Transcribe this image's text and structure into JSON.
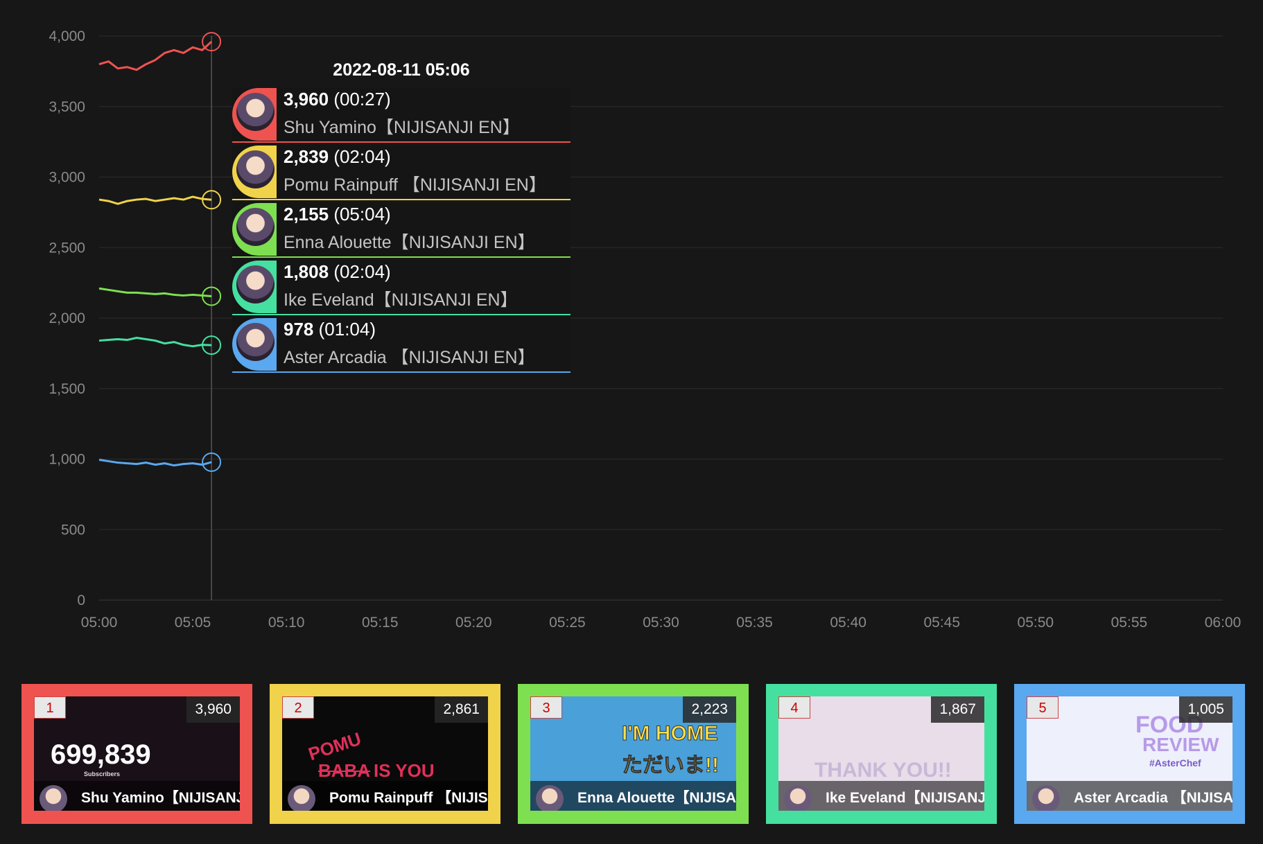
{
  "chart_data": {
    "type": "line",
    "title": "",
    "xlabel": "",
    "ylabel": "",
    "ylim": [
      0,
      4000
    ],
    "xlim": [
      "05:00",
      "06:00"
    ],
    "yticks": [
      "0",
      "500",
      "1,000",
      "1,500",
      "2,000",
      "2,500",
      "3,000",
      "3,500",
      "4,000"
    ],
    "xticks": [
      "05:00",
      "05:05",
      "05:10",
      "05:15",
      "05:20",
      "05:25",
      "05:30",
      "05:35",
      "05:40",
      "05:45",
      "05:50",
      "05:55",
      "06:00"
    ],
    "grid": true,
    "cursor_x": 6,
    "series": [
      {
        "name": "Shu Yamino【NIJISANJI EN】",
        "color": "#ef5350",
        "x": [
          0,
          0.5,
          1,
          1.5,
          2,
          2.5,
          3,
          3.5,
          4,
          4.5,
          5,
          5.5,
          6
        ],
        "values": [
          3800,
          3820,
          3770,
          3780,
          3760,
          3800,
          3830,
          3880,
          3900,
          3880,
          3920,
          3900,
          3960
        ]
      },
      {
        "name": "Pomu Rainpuff 【NIJISANJI EN】",
        "color": "#f0d34a",
        "x": [
          0,
          0.5,
          1,
          1.5,
          2,
          2.5,
          3,
          3.5,
          4,
          4.5,
          5,
          5.5,
          6
        ],
        "values": [
          2840,
          2830,
          2810,
          2830,
          2840,
          2845,
          2830,
          2840,
          2850,
          2840,
          2860,
          2845,
          2839
        ]
      },
      {
        "name": "Enna Alouette【NIJISANJI EN】",
        "color": "#7ee050",
        "x": [
          0,
          0.5,
          1,
          1.5,
          2,
          2.5,
          3,
          3.5,
          4,
          4.5,
          5,
          5.5,
          6
        ],
        "values": [
          2210,
          2200,
          2190,
          2180,
          2180,
          2175,
          2170,
          2175,
          2165,
          2160,
          2165,
          2160,
          2155
        ]
      },
      {
        "name": "Ike Eveland【NIJISANJI EN】",
        "color": "#45e0a0",
        "x": [
          0,
          0.5,
          1,
          1.5,
          2,
          2.5,
          3,
          3.5,
          4,
          4.5,
          5,
          5.5,
          6
        ],
        "values": [
          1840,
          1845,
          1850,
          1845,
          1860,
          1850,
          1840,
          1820,
          1830,
          1810,
          1800,
          1810,
          1808
        ]
      },
      {
        "name": "Aster Arcadia 【NIJISANJI EN】",
        "color": "#5aa8ef",
        "x": [
          0,
          0.5,
          1,
          1.5,
          2,
          2.5,
          3,
          3.5,
          4,
          4.5,
          5,
          5.5,
          6
        ],
        "values": [
          995,
          985,
          975,
          970,
          965,
          975,
          960,
          970,
          955,
          965,
          970,
          960,
          978
        ]
      }
    ]
  },
  "tooltip": {
    "title": "2022-08-11 05:06",
    "rows": [
      {
        "value": "3,960",
        "time": "(00:27)",
        "name": "Shu Yamino【NIJISANJI EN】",
        "color": "#ef5350"
      },
      {
        "value": "2,839",
        "time": "(02:04)",
        "name": "Pomu Rainpuff 【NIJISANJI EN】",
        "color": "#f0d34a"
      },
      {
        "value": "2,155",
        "time": "(05:04)",
        "name": "Enna Alouette【NIJISANJI EN】",
        "color": "#7ee050"
      },
      {
        "value": "1,808",
        "time": "(02:04)",
        "name": "Ike Eveland【NIJISANJI EN】",
        "color": "#45e0a0"
      },
      {
        "value": "978",
        "time": "(01:04)",
        "name": "Aster Arcadia 【NIJISANJI EN】",
        "color": "#5aa8ef"
      }
    ]
  },
  "cards": [
    {
      "rank": "1",
      "value": "3,960",
      "name": "Shu Yamino【NIJISANJI EN】",
      "color": "#ef5350",
      "big": "699,839",
      "sub": "Subscribers",
      "thumb_bg": "#1a1018"
    },
    {
      "rank": "2",
      "value": "2,861",
      "name": "Pomu Rainpuff 【NIJISANJI EN】",
      "color": "#f0d34a",
      "thumb_bg": "#0a0a0a",
      "deco1": "POMU",
      "deco2": "BABA",
      "deco3": "IS YOU"
    },
    {
      "rank": "3",
      "value": "2,223",
      "name": "Enna Alouette【NIJISANJI EN】",
      "color": "#7ee050",
      "thumb_bg": "#4aa0d8",
      "deco1": "I'M HOME",
      "deco2": "ただいま!!"
    },
    {
      "rank": "4",
      "value": "1,867",
      "name": "Ike Eveland【NIJISANJI EN】",
      "color": "#45e0a0",
      "thumb_bg": "#e8dde8",
      "deco1": "THANK YOU!!"
    },
    {
      "rank": "5",
      "value": "1,005",
      "name": "Aster Arcadia 【NIJISANJI EN】",
      "color": "#5aa8ef",
      "thumb_bg": "#eef0fb",
      "deco1": "FOOD",
      "deco2": "REVIEW",
      "deco3": "#AsterChef"
    }
  ]
}
